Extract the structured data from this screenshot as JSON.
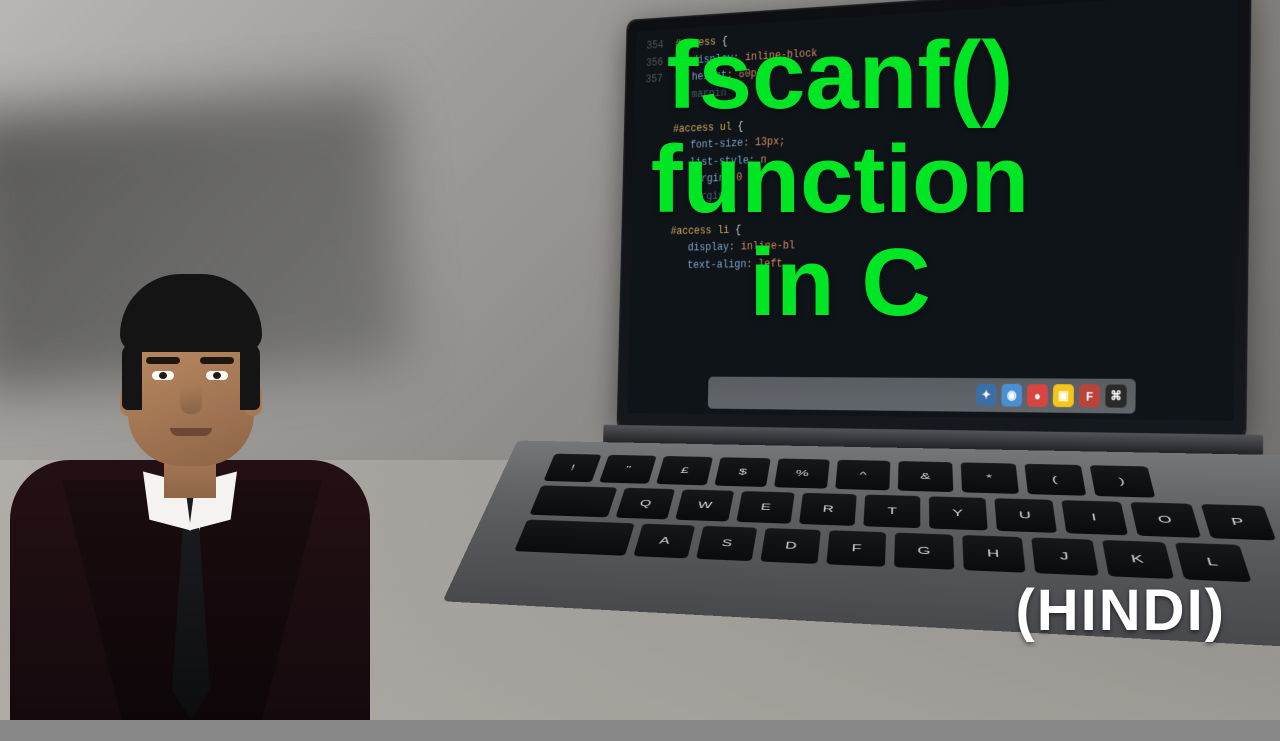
{
  "title_lines": [
    "fscanf()",
    "function",
    "in  C"
  ],
  "subtitle": "(HINDI)",
  "code": {
    "l1_num": "354",
    "l1_sel": "#access",
    "l1_brace": " {",
    "l2_num": "356",
    "l2_prop": "   display",
    "l2_val": ": inline-block",
    "l3_num": "357",
    "l3_prop": "   height",
    "l3_val": ": 60p",
    "l6_sel": "#access ul",
    "l6_brace": " {",
    "l7_prop": "   font-size",
    "l7_val": ": 13px;",
    "l8_prop": "   list-style",
    "l8_val": ": n",
    "l9_prop": "   margin",
    "l9_val": ": 0 0",
    "l12_sel": "#access li",
    "l12_brace": " {",
    "l13_prop": "   display",
    "l13_val": ": inline-bl",
    "l14_prop": "   text-align",
    "l14_val": ": left"
  },
  "dock_icons": [
    {
      "bg": "#3a6ea5",
      "glyph": "✦"
    },
    {
      "bg": "#4a8fd6",
      "glyph": "◉"
    },
    {
      "bg": "#d64541",
      "glyph": "●"
    },
    {
      "bg": "#f5c518",
      "glyph": "▣"
    },
    {
      "bg": "#b9443a",
      "glyph": "F"
    },
    {
      "bg": "#2a2a2a",
      "glyph": "⌘"
    }
  ],
  "keys_row1": [
    "!",
    "\"",
    "£",
    "$",
    "%",
    "^",
    "&",
    "*",
    "(",
    ")"
  ],
  "keys_row2": [
    "Q",
    "W",
    "E",
    "R",
    "T",
    "Y",
    "U",
    "I",
    "O",
    "P"
  ],
  "keys_row3": [
    "A",
    "S",
    "D",
    "F",
    "G",
    "H",
    "J",
    "K",
    "L"
  ]
}
